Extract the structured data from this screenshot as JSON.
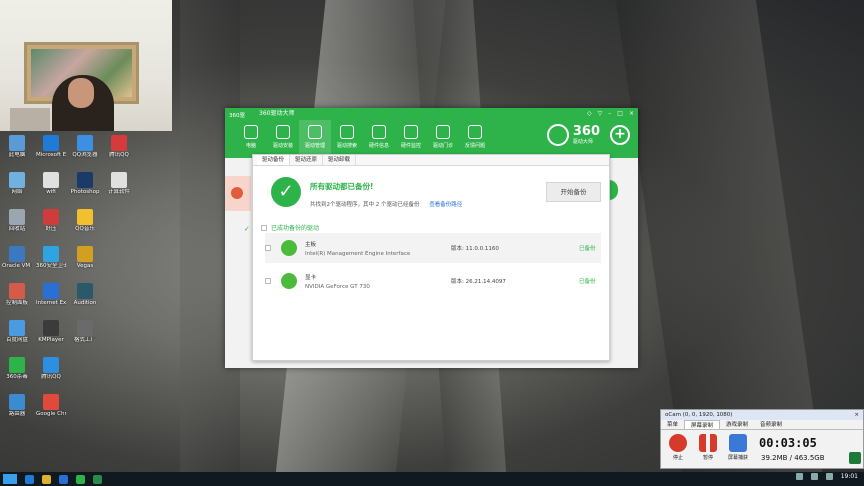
{
  "webcam": {
    "label": "webcam overlay"
  },
  "desktop_icons": [
    {
      "label": "此电脑",
      "color": "#5a9ad6"
    },
    {
      "label": "网络",
      "color": "#6fb2e0"
    },
    {
      "label": "回收站",
      "color": "#9aa6b0"
    },
    {
      "label": "Oracle VM VirtualBox",
      "color": "#3c78c0"
    },
    {
      "label": "控制面板",
      "color": "#d45a4a"
    },
    {
      "label": "百度网盘",
      "color": "#4c9be0"
    },
    {
      "label": "360杀毒",
      "color": "#2eb34a"
    },
    {
      "label": "路由器",
      "color": "#3a8bd0"
    },
    {
      "label": "Microsoft Edge",
      "color": "#1f7bd6"
    },
    {
      "label": "wifi",
      "color": "#e0e0e0"
    },
    {
      "label": "好压",
      "color": "#d03c3c"
    },
    {
      "label": "360安全卫士",
      "color": "#2ea4e0"
    },
    {
      "label": "Internet Explorer",
      "color": "#2a6fd6"
    },
    {
      "label": "KMPlayer",
      "color": "#3b3b3b"
    },
    {
      "label": "腾讯QQ",
      "color": "#2c8fe0"
    },
    {
      "label": "Google Chrome",
      "color": "#e04a3a"
    },
    {
      "label": "QQ浏览器",
      "color": "#3d8fe0"
    },
    {
      "label": "Photoshop",
      "color": "#1a3a6a"
    },
    {
      "label": "QQ音乐",
      "color": "#f2c02e"
    },
    {
      "label": "Vegas",
      "color": "#d0a020"
    },
    {
      "label": "Audition",
      "color": "#2a5a6a"
    },
    {
      "label": "格式工厂",
      "color": "#6a6a6a"
    },
    {
      "label": "腾讯QQ",
      "color": "#d63a3a"
    },
    {
      "label": "计算软件",
      "color": "#e0e0e0"
    }
  ],
  "win360": {
    "tag": "360驱",
    "title": "360驱动大师",
    "ctrl_icons": [
      "◇",
      "▽",
      "–",
      "□",
      "×"
    ],
    "tools": [
      {
        "label": "电脑",
        "name": "computer"
      },
      {
        "label": "驱动安装",
        "name": "driver-install"
      },
      {
        "label": "驱动管理",
        "name": "driver-manage"
      },
      {
        "label": "驱动搜索",
        "name": "driver-search"
      },
      {
        "label": "硬件信息",
        "name": "hardware-info"
      },
      {
        "label": "硬件监控",
        "name": "hardware-monitor"
      },
      {
        "label": "驱动门诊",
        "name": "driver-clinic"
      },
      {
        "label": "反馈问题",
        "name": "feedback"
      }
    ],
    "brand_main": "360",
    "brand_sub": "驱动大师",
    "plus": "+"
  },
  "panel": {
    "tabs": [
      "驱动备份",
      "驱动还原",
      "驱动卸载"
    ],
    "check": "✓",
    "status_title": "所有驱动都已备份!",
    "status_sub": "共找到2个驱动程序，其中 2 个驱动已经备份",
    "status_link": "查看备份路径",
    "start_button": "开始备份",
    "section_header": "已成功备份的驱动",
    "rows": [
      {
        "category": "主板",
        "name": "Intel(R) Management Engine Interface",
        "version": "版本: 11.0.0.1160",
        "status": "已备份"
      },
      {
        "category": "显卡",
        "name": "NVIDIA GeForce GT 730",
        "version": "版本: 26.21.14.4097",
        "status": "已备份"
      }
    ]
  },
  "ocam": {
    "title": "oCam (0, 0, 1920, 1080)",
    "close": "×",
    "tabs": [
      "菜单",
      "屏幕录制",
      "游戏录制",
      "音频录制"
    ],
    "buttons": [
      {
        "label": "停止",
        "color": "#d63a2a"
      },
      {
        "label": "暂停",
        "color": "#d63a2a"
      },
      {
        "label": "屏幕捕获",
        "color": "#3a7ad6"
      }
    ],
    "timer": "00:03:05",
    "size": "39.2MB / 463.5GB"
  },
  "taskbar": {
    "clock": "19:01"
  }
}
